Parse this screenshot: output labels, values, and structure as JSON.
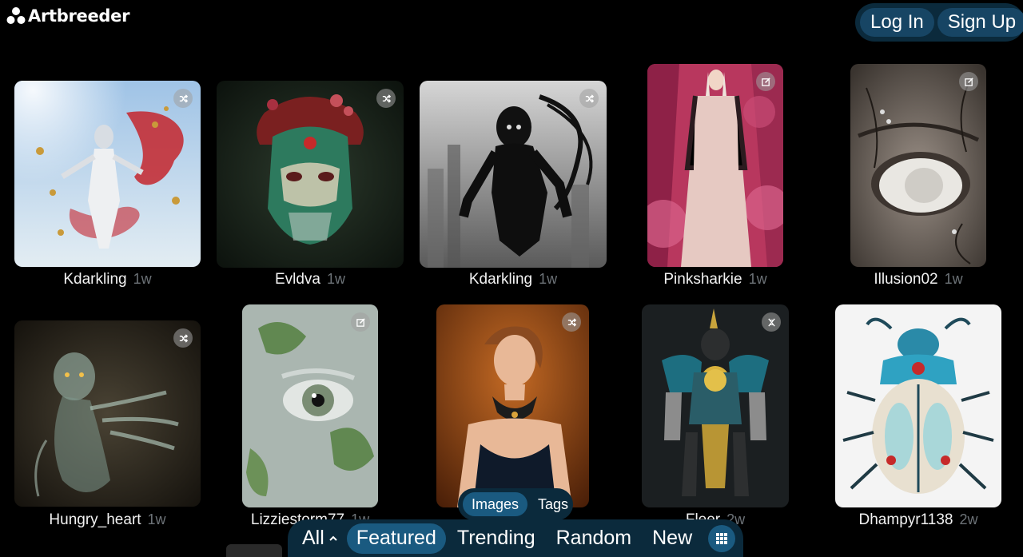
{
  "header": {
    "logo_text": "Artbreeder",
    "login_label": "Log In",
    "signup_label": "Sign Up"
  },
  "gallery": {
    "row1": [
      {
        "author": "Kdarkling",
        "age": "1w",
        "badge_icon": "shuffle-icon"
      },
      {
        "author": "Evldva",
        "age": "1w",
        "badge_icon": "shuffle-icon"
      },
      {
        "author": "Kdarkling",
        "age": "1w",
        "badge_icon": "shuffle-icon"
      },
      {
        "author": "Pinksharkie",
        "age": "1w",
        "badge_icon": "edit-icon"
      },
      {
        "author": "Illusion02",
        "age": "1w",
        "badge_icon": "edit-icon"
      }
    ],
    "row2": [
      {
        "author": "Hungry_heart",
        "age": "1w",
        "badge_icon": "shuffle-icon"
      },
      {
        "author": "Lizziestorm77",
        "age": "1w",
        "badge_icon": "edit-icon"
      },
      {
        "author": "",
        "age": "",
        "badge_icon": "shuffle-icon"
      },
      {
        "author": "Fleer",
        "age": "2w",
        "badge_icon": "dna-icon"
      },
      {
        "author": "Dhampyr1138",
        "age": "2w",
        "badge_icon": ""
      }
    ]
  },
  "content_type_toggle": {
    "images_label": "Images",
    "tags_label": "Tags",
    "active": "Images"
  },
  "filter_nav": {
    "all_label": "All",
    "featured_label": "Featured",
    "trending_label": "Trending",
    "random_label": "Random",
    "new_label": "New",
    "active": "Featured",
    "grid_icon": "grid-icon"
  },
  "colors": {
    "bar_bg": "#0b2a3c",
    "active_pill": "#1a5a80",
    "muted_text": "#6d7378"
  }
}
